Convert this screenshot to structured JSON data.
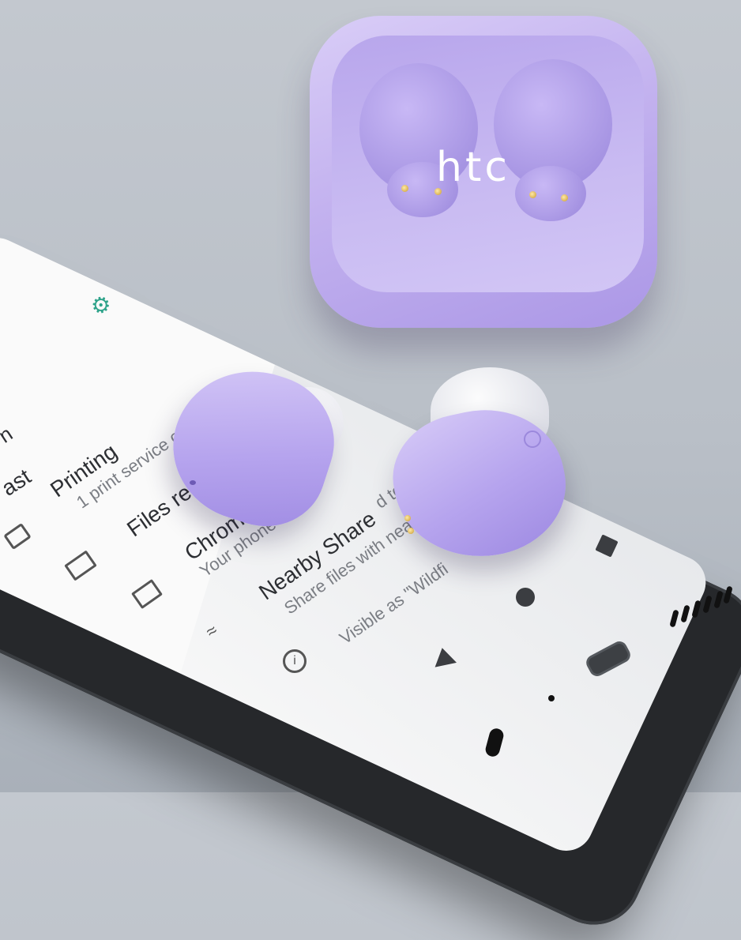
{
  "product": {
    "brand_logo": "htc"
  },
  "phone_screen": {
    "settings_rows": [
      {
        "title": "Printing",
        "subtitle": "1 print service on"
      },
      {
        "title": "Files rece",
        "subtitle": ""
      },
      {
        "title": "Chromebo",
        "subtitle": "Your phone is"
      },
      {
        "title": "Nearby Share",
        "subtitle": "Share files with nea"
      },
      {
        "title": "",
        "subtitle": "Visible as \"Wildfi"
      }
    ],
    "partial_texts": {
      "cast": "ast",
      "left_fragment": "n",
      "right_fragment": "d to a Chromebo"
    },
    "icons": [
      "gear-icon",
      "print-icon",
      "folder-icon",
      "devices-icon",
      "nearby-share-icon",
      "info-icon"
    ]
  },
  "nav_bar": [
    "recents-button",
    "home-button",
    "back-button"
  ],
  "colors": {
    "case_purple": "#c3b2ef",
    "gear_green": "#2ea38a",
    "phone_black": "#26282b"
  }
}
